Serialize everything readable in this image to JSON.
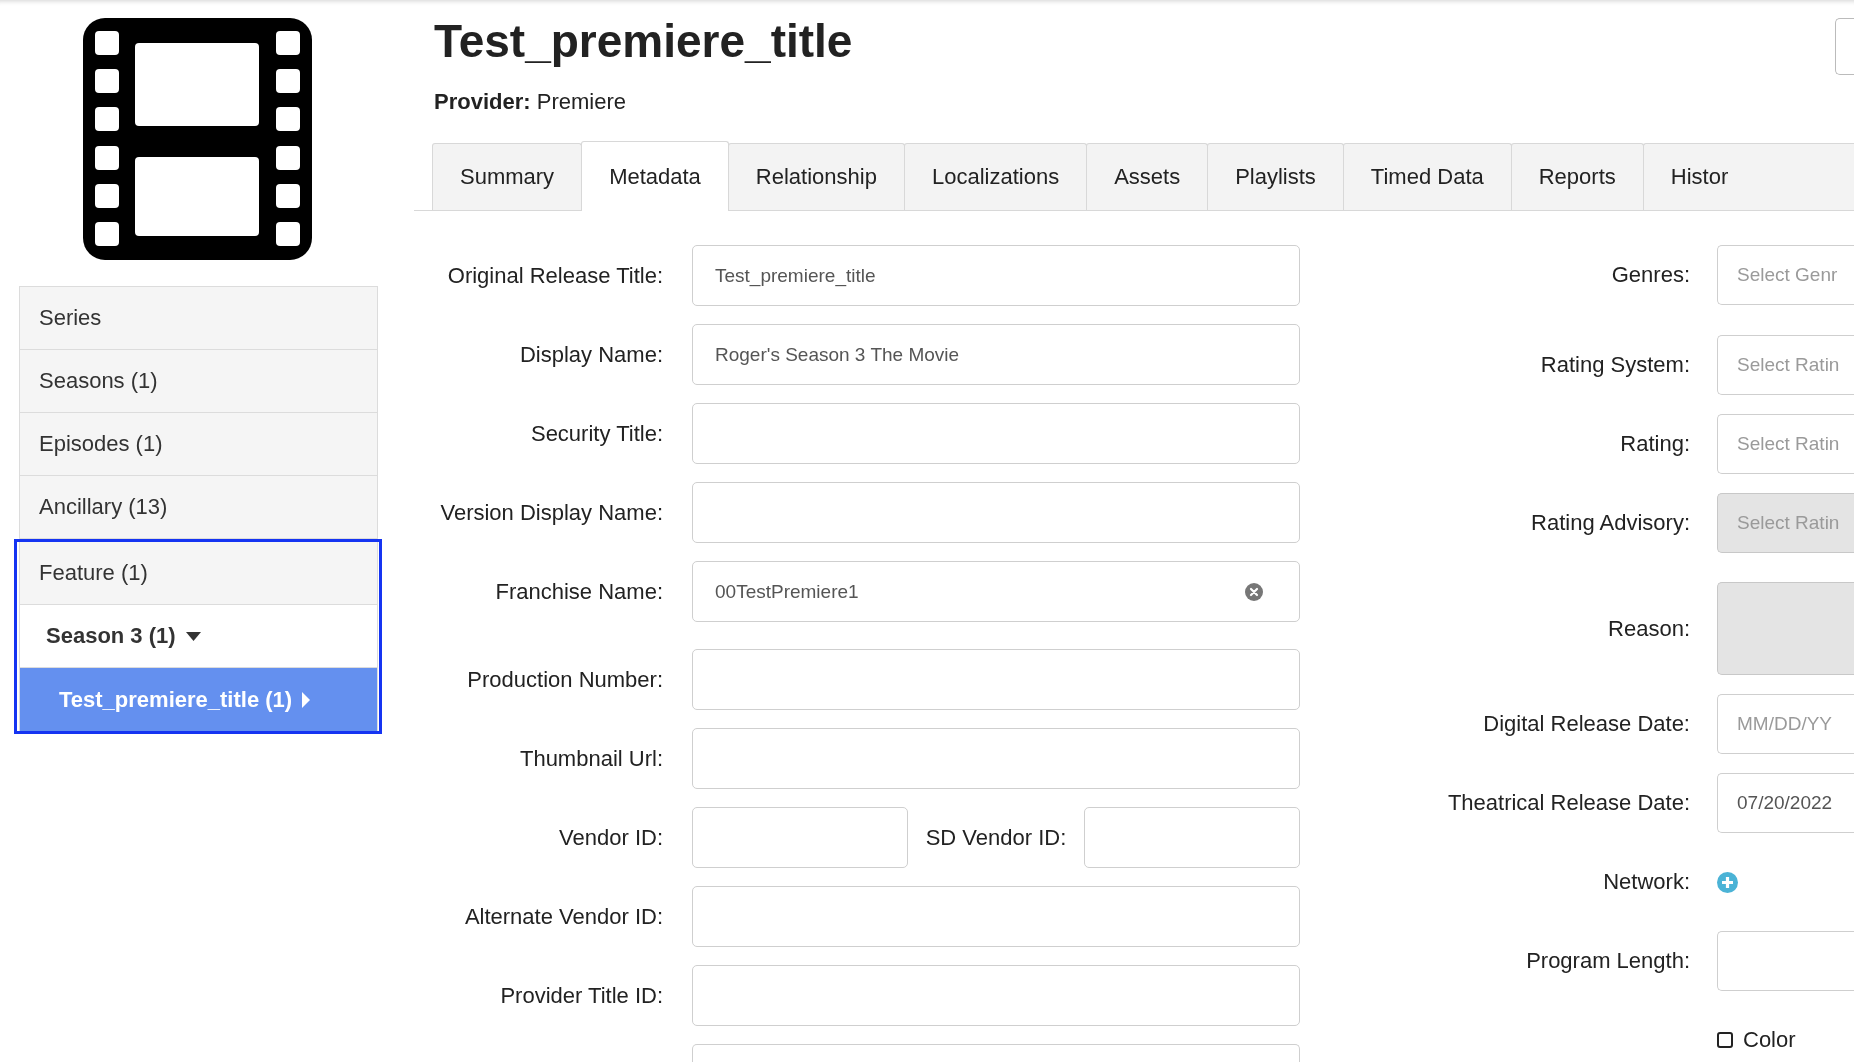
{
  "title": "Test_premiere_title",
  "provider": "**Provider:** Premiere",
  "tabs": [
    {
      "label": "Summary",
      "selected": false
    },
    {
      "label": "Metadata",
      "selected": true
    },
    {
      "label": "Relationship",
      "selected": false
    },
    {
      "label": "Localizations",
      "selected": false
    },
    {
      "label": "Assets",
      "selected": false
    },
    {
      "label": "Playlists",
      "selected": false
    },
    {
      "label": "Timed Data",
      "selected": false
    },
    {
      "label": "Reports",
      "selected": false
    },
    {
      "label": "Histor",
      "selected": false
    }
  ],
  "sidebar": {
    "items": [
      {
        "label": "Series",
        "selected": false,
        "highlighted": false
      },
      {
        "label": "Seasons (1)",
        "selected": false,
        "highlighted": false
      },
      {
        "label": "Episodes (1)",
        "selected": false,
        "highlighted": false
      },
      {
        "label": "Ancillary (13)",
        "selected": false,
        "highlighted": false
      },
      {
        "label": "Feature (1)",
        "selected": false,
        "highlighted": true,
        "children": [
          {
            "label": "Season 3 (1)",
            "selected": false,
            "expanded": true,
            "children": [
              {
                "label": "Test_premiere_title (1)",
                "selected": true,
                "expanded": false
              }
            ]
          }
        ]
      }
    ]
  },
  "form": {
    "left_fields": [
      {
        "kind": "text",
        "label": "Original Release Title:",
        "value": "Test_premiere_title"
      },
      {
        "kind": "text",
        "label": "Display Name:",
        "value": "Roger's Season 3 The Movie"
      },
      {
        "kind": "text",
        "label": "Security Title:"
      },
      {
        "kind": "text",
        "label": "Version Display Name:"
      },
      {
        "kind": "select",
        "label": "Franchise Name:",
        "value": "00TestPremiere1",
        "clearable": true
      },
      {
        "kind": "text",
        "label": "Production Number:"
      },
      {
        "kind": "text",
        "label": "Thumbnail Url:"
      },
      {
        "kind": "pair",
        "label": "Vendor ID:",
        "second_label": "SD Vendor ID:"
      },
      {
        "kind": "text",
        "label": "Alternate Vendor ID:"
      },
      {
        "kind": "text",
        "label": "Provider Title ID:"
      },
      {
        "kind": "text"
      }
    ],
    "right_fields": [
      {
        "kind": "select",
        "label": "Genres:",
        "placeholder": "Select Genr",
        "disabled": false
      },
      {
        "kind": "select",
        "label": "Rating System:",
        "placeholder": "Select Ratin",
        "disabled": false
      },
      {
        "kind": "select",
        "label": "Rating:",
        "placeholder": "Select Ratin",
        "disabled": false
      },
      {
        "kind": "select",
        "label": "Rating Advisory:",
        "placeholder": "Select Ratin",
        "disabled": true
      },
      {
        "kind": "textarea",
        "label": "Reason:",
        "disabled": true
      },
      {
        "kind": "date",
        "label": "Digital Release Date:",
        "placeholder": "MM/DD/YY",
        "disabled": false
      },
      {
        "kind": "date",
        "label": "Theatrical Release Date:",
        "value": "07/20/2022",
        "disabled": false
      },
      {
        "kind": "add",
        "label": "Network:"
      },
      {
        "kind": "text",
        "label": "Program Length:",
        "disabled": false
      },
      {
        "kind": "checkbox",
        "label": "Color",
        "checked": false
      }
    ]
  }
}
